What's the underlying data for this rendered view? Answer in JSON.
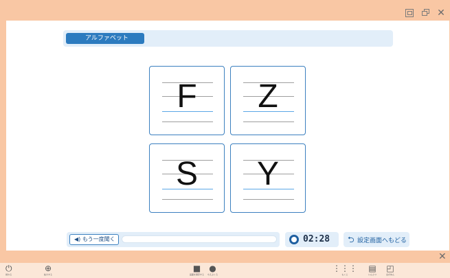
{
  "window": {
    "close_symbol": "✕"
  },
  "header": {
    "title": "アルファベット"
  },
  "cards": [
    {
      "letter": "F"
    },
    {
      "letter": "Z"
    },
    {
      "letter": "S"
    },
    {
      "letter": "Y"
    }
  ],
  "controls": {
    "replay_label": "もう一度聞く",
    "timer": "02:28",
    "back_label": "設定画面へもどる",
    "back_ruby": "せってい"
  },
  "toolbar": {
    "items": [
      {
        "icon": "power-icon",
        "caption": "終わる"
      },
      {
        "icon": "zoom-icon",
        "caption": "拡大する"
      },
      {
        "icon": "camera-icon",
        "caption": "画面を保存する"
      },
      {
        "icon": "lightbulb-icon",
        "caption": "ちえぶくろ"
      },
      {
        "icon": "grid-icon",
        "caption": "もくじ"
      },
      {
        "icon": "print-icon",
        "caption": "いんさつ"
      },
      {
        "icon": "fullscreen-icon",
        "caption": "全がめん"
      }
    ]
  },
  "colors": {
    "accent": "#2c7bbf",
    "frame": "#f9c7a4",
    "panel_tint": "#e2eef9"
  }
}
